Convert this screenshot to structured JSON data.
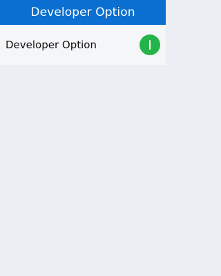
{
  "header": {
    "title": "Developer Option"
  },
  "settings": {
    "items": [
      {
        "label": "Developer Option",
        "toggle_state": "on",
        "toggle_color": "#24b44a"
      }
    ]
  },
  "colors": {
    "header_bg": "#0a6fd0",
    "page_bg": "#ebeef2",
    "row_bg": "#f5f6f8"
  }
}
